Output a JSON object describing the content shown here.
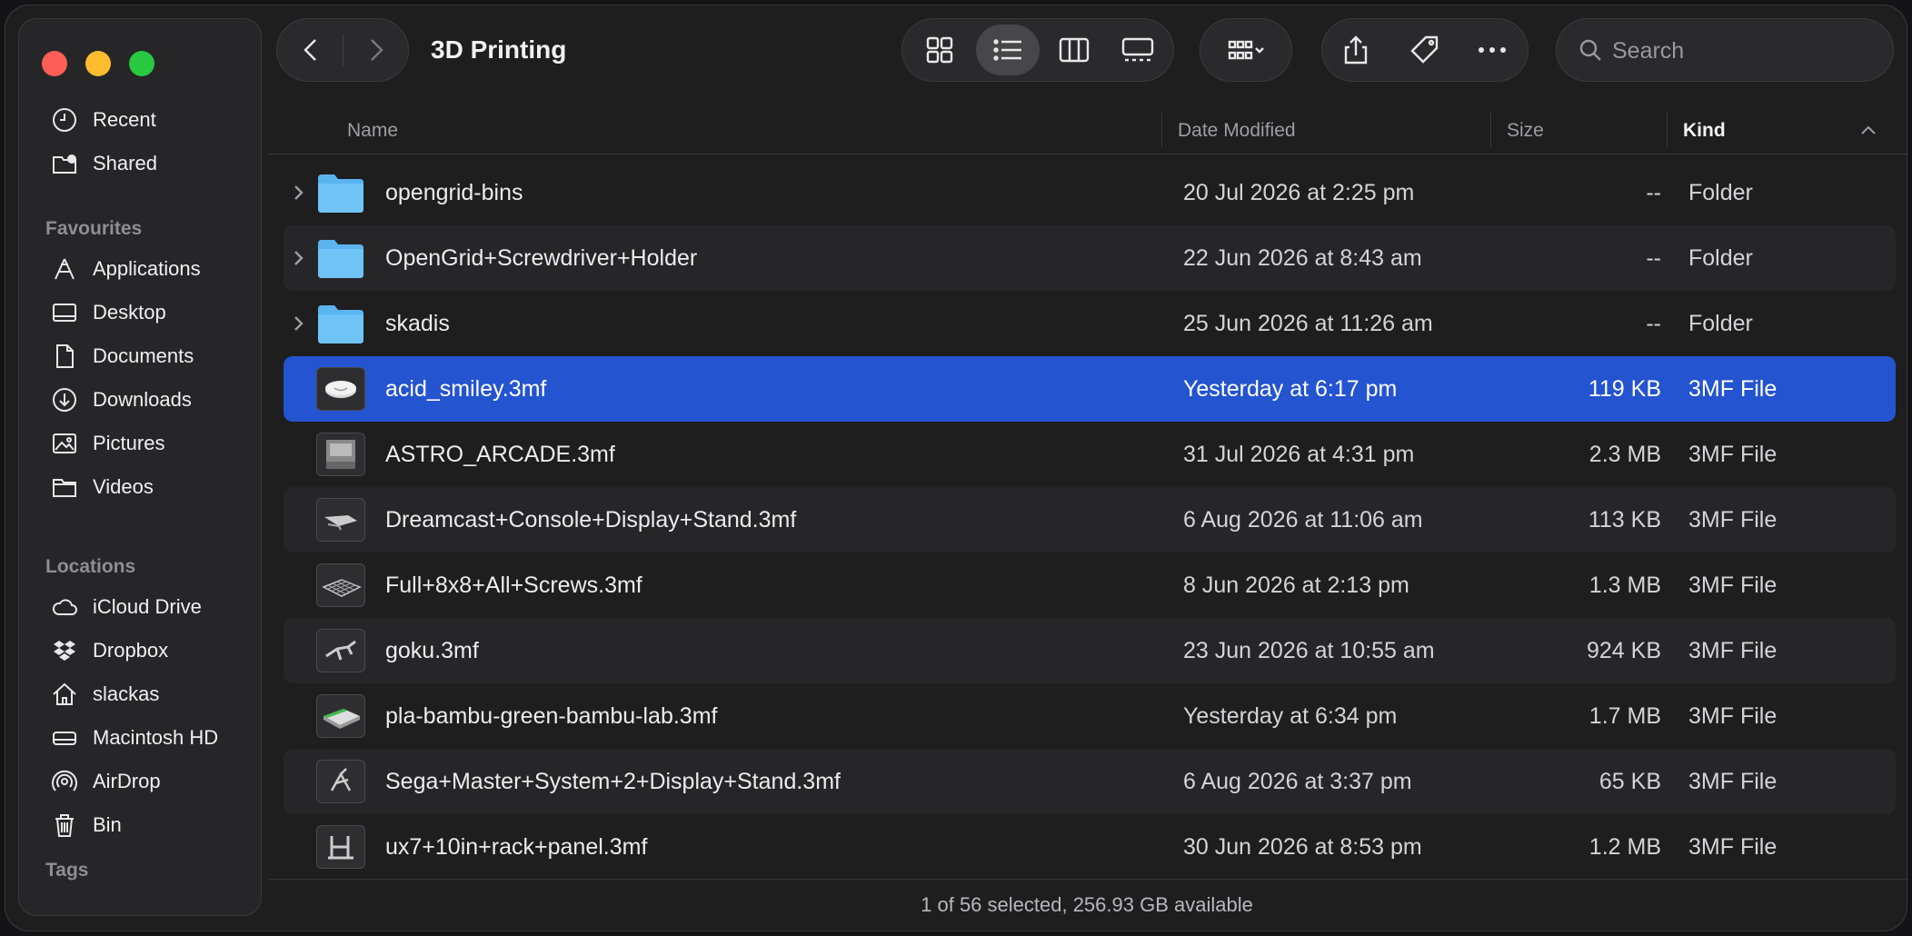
{
  "window": {
    "title": "3D Printing"
  },
  "search": {
    "placeholder": "Search"
  },
  "sidebar": {
    "top_items": [
      {
        "label": "Recent",
        "icon": "clock-icon"
      },
      {
        "label": "Shared",
        "icon": "shared-folder-icon"
      }
    ],
    "favourites_header": "Favourites",
    "favourites": [
      {
        "label": "Applications",
        "icon": "applications-icon"
      },
      {
        "label": "Desktop",
        "icon": "desktop-icon"
      },
      {
        "label": "Documents",
        "icon": "document-icon"
      },
      {
        "label": "Downloads",
        "icon": "download-icon"
      },
      {
        "label": "Pictures",
        "icon": "photo-icon"
      },
      {
        "label": "Videos",
        "icon": "folder-icon"
      }
    ],
    "locations_header": "Locations",
    "locations": [
      {
        "label": "iCloud Drive",
        "icon": "cloud-icon"
      },
      {
        "label": "Dropbox",
        "icon": "dropbox-icon"
      },
      {
        "label": "slackas",
        "icon": "home-icon"
      },
      {
        "label": "Macintosh HD",
        "icon": "disk-icon"
      },
      {
        "label": "AirDrop",
        "icon": "airdrop-icon"
      },
      {
        "label": "Bin",
        "icon": "trash-icon"
      }
    ],
    "tags_header": "Tags"
  },
  "columns": {
    "name": "Name",
    "date": "Date Modified",
    "size": "Size",
    "kind": "Kind"
  },
  "files": [
    {
      "name": "opengrid-bins",
      "date": "20 Jul 2026 at 2:25 pm",
      "size": "--",
      "kind": "Folder",
      "type": "folder"
    },
    {
      "name": "OpenGrid+Screwdriver+Holder",
      "date": "22 Jun 2026 at 8:43 am",
      "size": "--",
      "kind": "Folder",
      "type": "folder"
    },
    {
      "name": "skadis",
      "date": "25 Jun 2026 at 11:26 am",
      "size": "--",
      "kind": "Folder",
      "type": "folder"
    },
    {
      "name": "acid_smiley.3mf",
      "date": "Yesterday at 6:17 pm",
      "size": "119 KB",
      "kind": "3MF File",
      "type": "file",
      "selected": true
    },
    {
      "name": "ASTRO_ARCADE.3mf",
      "date": "31 Jul 2026 at 4:31 pm",
      "size": "2.3 MB",
      "kind": "3MF File",
      "type": "file"
    },
    {
      "name": "Dreamcast+Console+Display+Stand.3mf",
      "date": "6 Aug 2026 at 11:06 am",
      "size": "113 KB",
      "kind": "3MF File",
      "type": "file"
    },
    {
      "name": "Full+8x8+All+Screws.3mf",
      "date": "8 Jun 2026 at 2:13 pm",
      "size": "1.3 MB",
      "kind": "3MF File",
      "type": "file"
    },
    {
      "name": "goku.3mf",
      "date": "23 Jun 2026 at 10:55 am",
      "size": "924 KB",
      "kind": "3MF File",
      "type": "file"
    },
    {
      "name": "pla-bambu-green-bambu-lab.3mf",
      "date": "Yesterday at 6:34 pm",
      "size": "1.7 MB",
      "kind": "3MF File",
      "type": "file"
    },
    {
      "name": "Sega+Master+System+2+Display+Stand.3mf",
      "date": "6 Aug 2026 at 3:37 pm",
      "size": "65 KB",
      "kind": "3MF File",
      "type": "file"
    },
    {
      "name": "ux7+10in+rack+panel.3mf",
      "date": "30 Jun 2026 at 8:53 pm",
      "size": "1.2 MB",
      "kind": "3MF File",
      "type": "file"
    }
  ],
  "status": {
    "text": "1 of 56 selected, 256.93 GB available"
  },
  "colors": {
    "selection": "#2454cf",
    "folder": "#5ab4f0",
    "close": "#ff5f57",
    "minimize": "#febc2e",
    "maximize": "#28c840"
  }
}
